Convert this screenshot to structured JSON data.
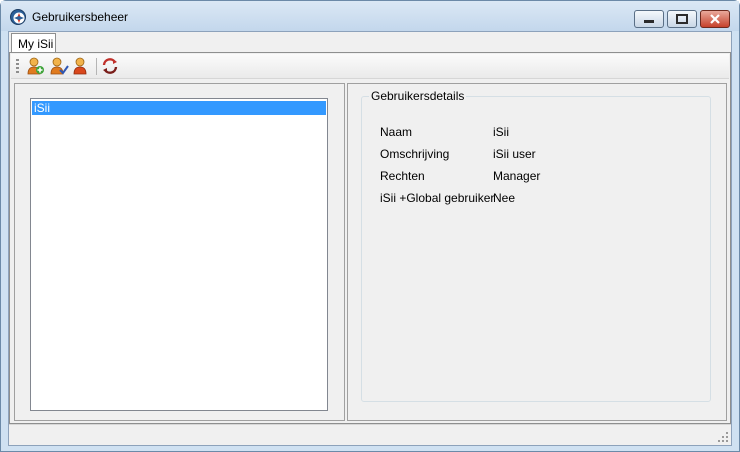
{
  "window": {
    "title": "Gebruikersbeheer",
    "accent_color": "#c3d7ec",
    "close_color": "#c6412a"
  },
  "tabs": [
    {
      "label": "My iSii",
      "selected": true
    }
  ],
  "toolbar": {
    "buttons": [
      {
        "icon": "add-user-icon"
      },
      {
        "icon": "edit-user-icon"
      },
      {
        "icon": "remove-user-icon"
      },
      {
        "icon": "refresh-icon"
      }
    ]
  },
  "user_list": {
    "items": [
      {
        "label": "iSii",
        "selected": true
      }
    ],
    "selection_color": "#3399ff"
  },
  "details": {
    "group_title": "Gebruikersdetails",
    "rows": [
      {
        "label": "Naam",
        "value": "iSii"
      },
      {
        "label": "Omschrijving",
        "value": "iSii user"
      },
      {
        "label": "Rechten",
        "value": "Manager"
      },
      {
        "label": "iSii +Global gebruiker",
        "value": "Nee"
      }
    ]
  }
}
